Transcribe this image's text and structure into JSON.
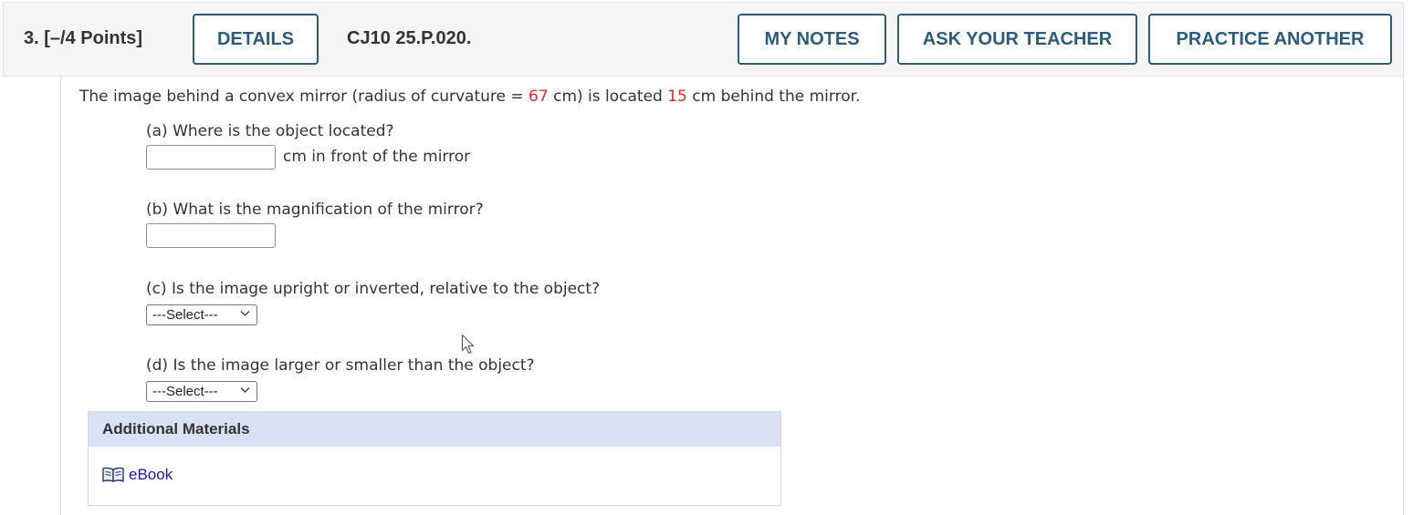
{
  "question": {
    "number_points": "3.  [–/4 Points]",
    "details_label": "DETAILS",
    "code": "CJ10 25.P.020.",
    "my_notes_label": "MY NOTES",
    "ask_teacher_label": "ASK YOUR TEACHER",
    "practice_another_label": "PRACTICE ANOTHER"
  },
  "stem": {
    "part1": "The image behind a convex mirror (radius of curvature = ",
    "radius": "67",
    "part2": " cm) is located ",
    "distance": "15",
    "part3": " cm behind the mirror."
  },
  "parts": {
    "a": {
      "prompt": "(a) Where is the object located?",
      "value": "",
      "unit": "cm in front of the mirror"
    },
    "b": {
      "prompt": "(b) What is the magnification of the mirror?",
      "value": ""
    },
    "c": {
      "prompt": "(c) Is the image upright or inverted, relative to the object?",
      "selected": "---Select---"
    },
    "d": {
      "prompt": "(d) Is the image larger or smaller than the object?",
      "selected": "---Select---"
    }
  },
  "materials": {
    "header": "Additional Materials",
    "ebook_label": "eBook"
  },
  "colors": {
    "button_border": "#2c5b7c",
    "highlight_red": "#e8262b",
    "materials_header_bg": "#d9e1f5",
    "link": "#1a1aa6"
  },
  "icons": [
    "chevron-down-icon",
    "book-icon",
    "mouse-cursor-icon"
  ]
}
